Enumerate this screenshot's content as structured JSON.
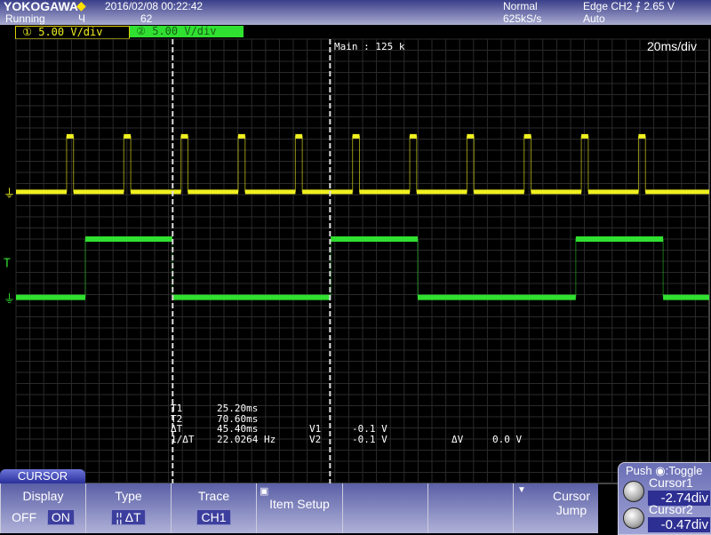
{
  "header": {
    "brand": "YOKOGAWA",
    "status": "Running",
    "datetime": "2016/02/08 00:22:42",
    "count": "62",
    "acq_mode": "Normal",
    "sample_rate": "625kS/s",
    "trigger": "Edge CH2",
    "trigger_slope": "falling",
    "trigger_level": "2.65 V",
    "trigger_mode": "Auto"
  },
  "channels": [
    {
      "num": "1",
      "scale": "5.00 V/div",
      "color": "#f0f020"
    },
    {
      "num": "2",
      "scale": "5.00 V/div",
      "color": "#30e030"
    }
  ],
  "screen": {
    "main_label": "Main : 125 k",
    "timebase": "20ms/div"
  },
  "chart_data": {
    "type": "line",
    "xlim_ms": [
      -100,
      100
    ],
    "divisions": {
      "x": 10,
      "y": 8
    },
    "grid": true,
    "series": [
      {
        "channel": "1",
        "color": "#f0f020",
        "ground_div": 1.25,
        "pulse_height_div": 1,
        "pulse_width_ms": 2,
        "pulse_rises_ms": [
          -85.4,
          -68.9,
          -52.4,
          -35.9,
          -19.4,
          -2.9,
          13.6,
          30.1,
          46.6,
          63.1,
          79.6
        ]
      },
      {
        "channel": "2",
        "color": "#30e030",
        "ground_div": -0.65,
        "high_div": 1.05,
        "edges_ms": [
          [
            -80,
            -54.9
          ],
          [
            -9.2,
            15.9
          ],
          [
            61.5,
            86.7
          ]
        ]
      }
    ],
    "cursors_div": [
      -2.74,
      -0.47
    ]
  },
  "measurements": {
    "rows": [
      {
        "label": "T1",
        "value": "25.20ms"
      },
      {
        "label": "T2",
        "value": "70.60ms"
      },
      {
        "label": "ΔT",
        "value": "45.40ms"
      },
      {
        "label": "1/ΔT",
        "value": "22.0264 Hz"
      }
    ],
    "v1_label": "V1",
    "v1": "-0.1 V",
    "v2_label": "V2",
    "v2": "-0.1 V",
    "dv_label": "ΔV",
    "dv": "0.0 V"
  },
  "menu": {
    "tab": "CURSOR",
    "display": {
      "label": "Display",
      "off": "OFF",
      "on": "ON"
    },
    "type": {
      "label": "Type",
      "value": "¦¦ ΔT"
    },
    "trace": {
      "label": "Trace",
      "value": "CH1"
    },
    "item_setup": "Item Setup",
    "cursor_jump": "Cursor Jump"
  },
  "knobs": {
    "hint": "Push ◉:Toggle",
    "cursor1": "Cursor1",
    "cursor1_value": "-2.74div",
    "cursor2": "Cursor2",
    "cursor2_value": "-0.47div"
  }
}
